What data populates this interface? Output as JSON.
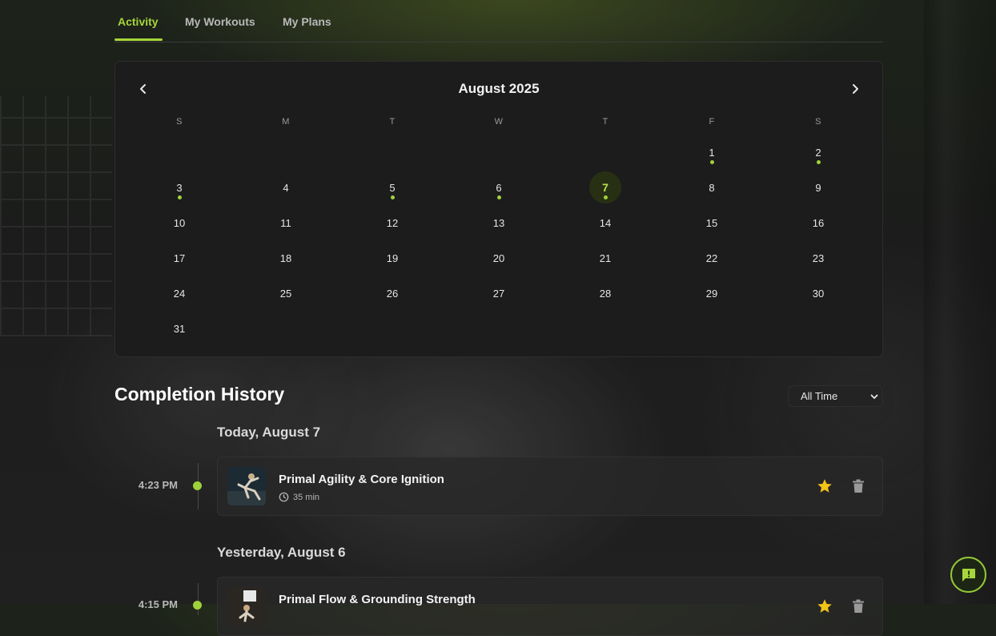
{
  "tabs": [
    {
      "label": "Activity",
      "active": true
    },
    {
      "label": "My Workouts",
      "active": false
    },
    {
      "label": "My Plans",
      "active": false
    }
  ],
  "calendar": {
    "month_label": "August 2025",
    "prev_icon": "chevron-left-icon",
    "next_icon": "chevron-right-icon",
    "weekdays": [
      "S",
      "M",
      "T",
      "W",
      "T",
      "F",
      "S"
    ],
    "first_weekday_index": 5,
    "days_in_month": 31,
    "today": 7,
    "activity_days": [
      1,
      2,
      3,
      5,
      6,
      7
    ],
    "accent_color": "#9fd23a"
  },
  "history": {
    "title": "Completion History",
    "filter": {
      "selected": "All Time"
    },
    "groups": [
      {
        "heading": "Today, August 7",
        "entries": [
          {
            "time": "4:23 PM",
            "title": "Primal Agility & Core Ignition",
            "duration": "35 min",
            "favorite": true
          }
        ]
      },
      {
        "heading": "Yesterday, August 6",
        "entries": [
          {
            "time": "4:15 PM",
            "title": "Primal Flow & Grounding Strength",
            "duration": "",
            "favorite": true
          }
        ]
      }
    ]
  },
  "icons": {
    "favorite": "star-icon",
    "delete": "trash-icon",
    "duration": "clock-icon",
    "feedback": "feedback-icon"
  },
  "colors": {
    "accent": "#a6d63a",
    "star": "#f2c318"
  }
}
